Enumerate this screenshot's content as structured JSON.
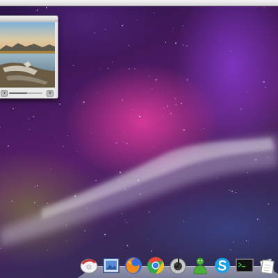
{
  "desktop": {
    "wallpaper": "aurora-galaxy",
    "colors": {
      "magenta": "#eb3ca0",
      "violet": "#8c3cdc",
      "deep_purple": "#46195e",
      "menubar": "#e6e6e6"
    }
  },
  "preview_window": {
    "content": "lake-landscape-photo",
    "progress": 0.55
  },
  "dock": {
    "items": [
      {
        "icon": "messenger-icon"
      },
      {
        "icon": "photo-viewer-icon"
      },
      {
        "icon": "firefox-icon"
      },
      {
        "icon": "chrome-icon"
      },
      {
        "icon": "audio-player-icon"
      },
      {
        "icon": "chat-buddy-icon"
      },
      {
        "icon": "skype-icon"
      },
      {
        "icon": "terminal-icon"
      },
      {
        "icon": "documents-icon"
      }
    ]
  }
}
